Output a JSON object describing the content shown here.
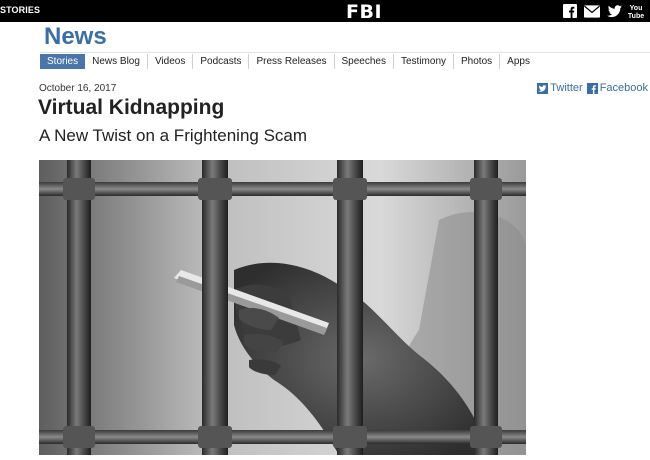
{
  "topbar": {
    "stories_label": "STORIES",
    "logo_text": "FBI",
    "social_icons": [
      "facebook-icon",
      "email-icon",
      "twitter-icon",
      "youtube-icon"
    ],
    "youtube_text": "You Tube"
  },
  "section": {
    "title": "News"
  },
  "nav": {
    "items": [
      "Stories",
      "News Blog",
      "Videos",
      "Podcasts",
      "Press Releases",
      "Speeches",
      "Testimony",
      "Photos",
      "Apps"
    ],
    "active_index": 0
  },
  "article": {
    "date": "October 16, 2017",
    "headline": "Virtual Kidnapping",
    "subheadline": "A New Twist on a Frightening Scam"
  },
  "share": {
    "twitter_label": "Twitter",
    "facebook_label": "Facebook"
  },
  "colors": {
    "brand_blue": "#3a6ea5",
    "nav_active": "#4a75a9",
    "topbar": "#000000"
  }
}
